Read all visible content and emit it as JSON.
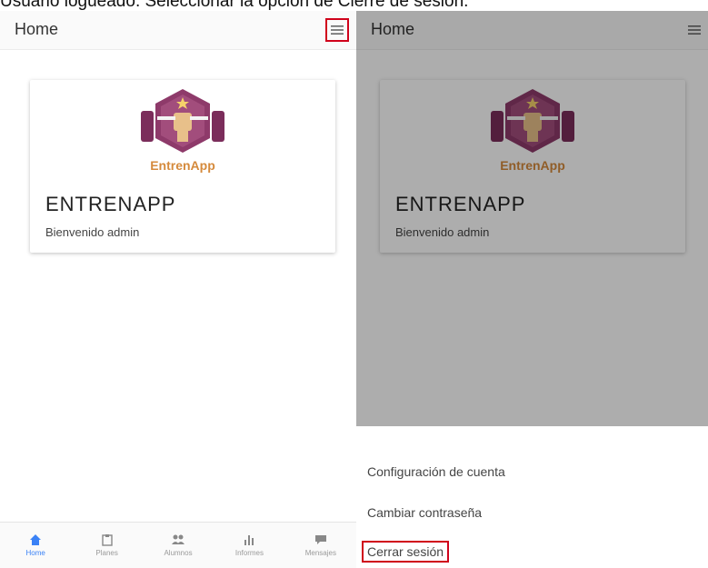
{
  "caption": "Usuario logueado. Seleccionar la opción de Cierre de sesión.",
  "left_screen": {
    "header": {
      "title": "Home",
      "menu_icon": "hamburger-menu-icon"
    },
    "card": {
      "logo_text": "EntrenApp",
      "title": "ENTRENAPP",
      "subtitle": "Bienvenido admin"
    },
    "tabs": [
      {
        "label": "Home",
        "icon": "home-icon",
        "active": true
      },
      {
        "label": "Planes",
        "icon": "clipboard-icon",
        "active": false
      },
      {
        "label": "Alumnos",
        "icon": "people-icon",
        "active": false
      },
      {
        "label": "Informes",
        "icon": "bar-chart-icon",
        "active": false
      },
      {
        "label": "Mensajes",
        "icon": "chat-icon",
        "active": false
      }
    ]
  },
  "right_screen": {
    "header": {
      "title": "Home",
      "menu_icon": "hamburger-menu-icon"
    },
    "card": {
      "logo_text": "EntrenApp",
      "title": "ENTRENAPP",
      "subtitle": "Bienvenido admin"
    },
    "menu": [
      {
        "label": "Configuración de cuenta"
      },
      {
        "label": "Cambiar contraseña"
      },
      {
        "label": "Cerrar sesión",
        "highlighted": true
      }
    ]
  },
  "colors": {
    "accent": "#3b82f6",
    "highlight_border": "#d0021b",
    "logo_purple": "#7b2d5b",
    "logo_orange": "#d58a3c"
  }
}
